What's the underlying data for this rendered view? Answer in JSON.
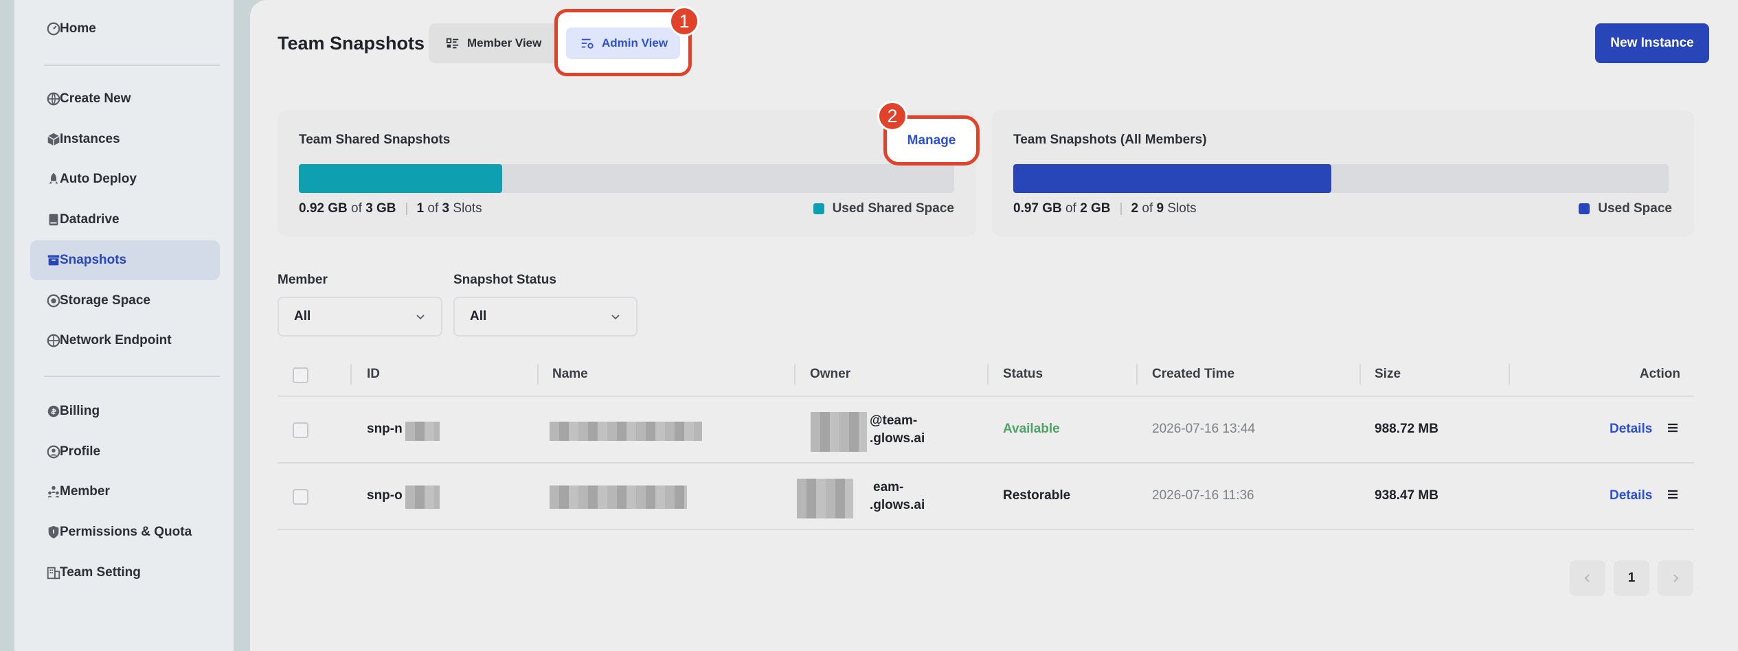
{
  "sidebar": {
    "items": [
      {
        "label": "Home",
        "icon": "dashboard-icon"
      },
      {
        "label": "Create New",
        "icon": "globe-plus-icon"
      },
      {
        "label": "Instances",
        "icon": "cube-icon"
      },
      {
        "label": "Auto Deploy",
        "icon": "rocket-icon"
      },
      {
        "label": "Datadrive",
        "icon": "drive-icon"
      },
      {
        "label": "Snapshots",
        "icon": "snapshot-icon",
        "active": true
      },
      {
        "label": "Storage Space",
        "icon": "storage-icon"
      },
      {
        "label": "Network Endpoint",
        "icon": "network-icon"
      },
      {
        "label": "Billing",
        "icon": "billing-icon"
      },
      {
        "label": "Profile",
        "icon": "profile-icon"
      },
      {
        "label": "Member",
        "icon": "member-icon"
      },
      {
        "label": "Permissions & Quota",
        "icon": "shield-icon"
      },
      {
        "label": "Team Setting",
        "icon": "building-icon"
      }
    ]
  },
  "header": {
    "title": "Team Snapshots",
    "member_view": "Member View",
    "admin_view": "Admin View",
    "new_instance": "New Instance",
    "badge1": "1",
    "badge2": "2"
  },
  "cards": {
    "shared": {
      "title": "Team Shared Snapshots",
      "manage": "Manage",
      "used": "0.92 GB",
      "of1": "of",
      "total": "3 GB",
      "slots_used": "1",
      "of2": "of",
      "slots_total": "3",
      "slots_label": "Slots",
      "legend": "Used Shared Space",
      "fill_fraction": 0.31,
      "color": "#0e9fb1"
    },
    "all": {
      "title": "Team Snapshots (All Members)",
      "used": "0.97 GB",
      "of1": "of",
      "total": "2 GB",
      "slots_used": "2",
      "of2": "of",
      "slots_total": "9",
      "slots_label": "Slots",
      "legend": "Used Space",
      "fill_fraction": 0.485,
      "color": "#2846b8"
    }
  },
  "filters": {
    "member_label": "Member",
    "member_value": "All",
    "status_label": "Snapshot Status",
    "status_value": "All"
  },
  "table": {
    "headers": [
      "ID",
      "Name",
      "Owner",
      "Status",
      "Created Time",
      "Size",
      "Action"
    ],
    "rows": [
      {
        "id": "snp-n",
        "owner_line1": "@team-",
        "owner_line2": ".glows.ai",
        "status": "Available",
        "created": "2026-07-16 13:44",
        "size": "988.72 MB",
        "action": "Details"
      },
      {
        "id": "snp-o",
        "owner_line1": "eam-",
        "owner_line2": ".glows.ai",
        "status": "Restorable",
        "created": "2026-07-16 11:36",
        "size": "938.47 MB",
        "action": "Details"
      }
    ]
  },
  "pagination": {
    "current": "1"
  }
}
